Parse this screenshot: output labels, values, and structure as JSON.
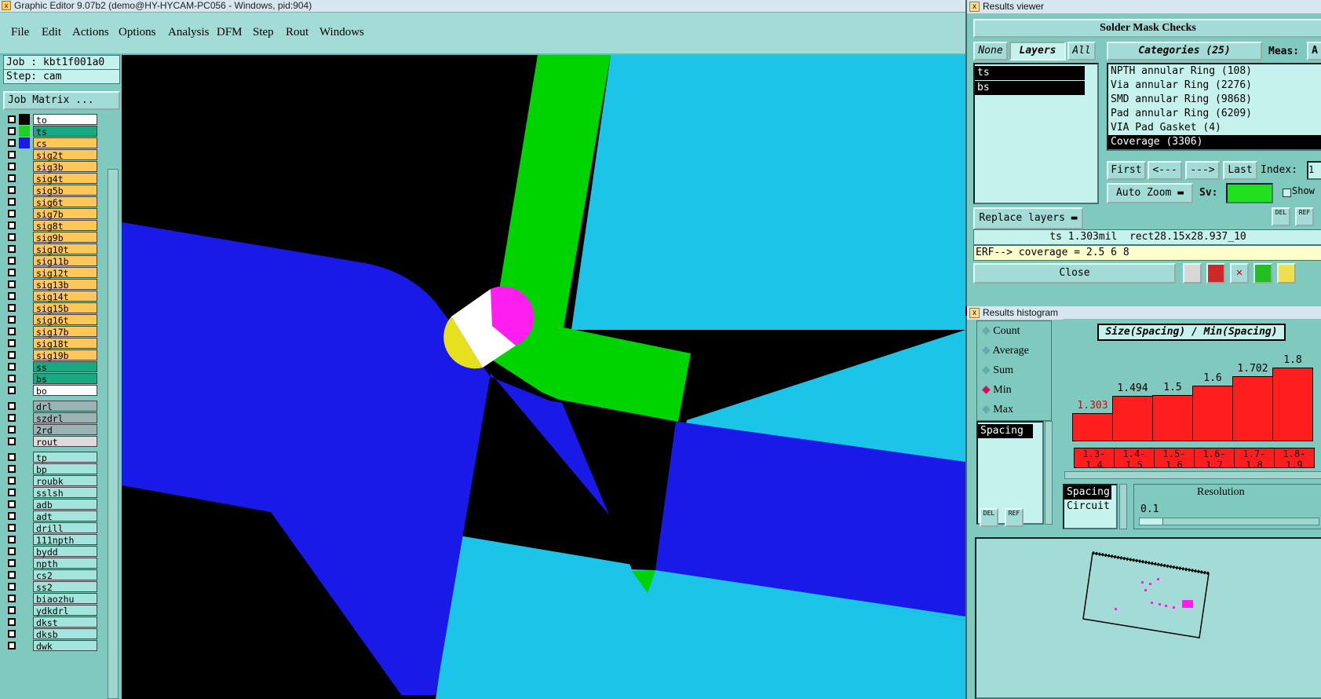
{
  "main_window": {
    "title": "Graphic Editor 9.07b2 (demo@HY-HYCAM-PC056 - Windows, pid:904)",
    "menu": [
      "File",
      "Edit",
      "Actions",
      "Options",
      "Analysis",
      "DFM",
      "Step",
      "Rout",
      "Windows"
    ],
    "job_label": "Job : kbt1f001a0",
    "step_label": "Step: cam",
    "job_matrix_button": "Job Matrix ..."
  },
  "layers": [
    {
      "name": "to",
      "color": "#ffffff",
      "swatch": "#000000"
    },
    {
      "name": "ts",
      "color": "#1aa883",
      "swatch": "#20d020"
    },
    {
      "name": "cs",
      "color": "#ffc65a",
      "swatch": "#1a1ae8"
    },
    {
      "name": "sig2t",
      "color": "#ffc65a",
      "swatch": ""
    },
    {
      "name": "sig3b",
      "color": "#ffc65a",
      "swatch": ""
    },
    {
      "name": "sig4t",
      "color": "#ffc65a",
      "swatch": ""
    },
    {
      "name": "sig5b",
      "color": "#ffc65a",
      "swatch": ""
    },
    {
      "name": "sig6t",
      "color": "#ffc65a",
      "swatch": ""
    },
    {
      "name": "sig7b",
      "color": "#ffc65a",
      "swatch": ""
    },
    {
      "name": "sig8t",
      "color": "#ffc65a",
      "swatch": ""
    },
    {
      "name": "sig9b",
      "color": "#ffc65a",
      "swatch": ""
    },
    {
      "name": "sig10t",
      "color": "#ffc65a",
      "swatch": ""
    },
    {
      "name": "sig11b",
      "color": "#ffc65a",
      "swatch": ""
    },
    {
      "name": "sig12t",
      "color": "#ffc65a",
      "swatch": ""
    },
    {
      "name": "sig13b",
      "color": "#ffc65a",
      "swatch": ""
    },
    {
      "name": "sig14t",
      "color": "#ffc65a",
      "swatch": ""
    },
    {
      "name": "sig15b",
      "color": "#ffc65a",
      "swatch": ""
    },
    {
      "name": "sig16t",
      "color": "#ffc65a",
      "swatch": ""
    },
    {
      "name": "sig17b",
      "color": "#ffc65a",
      "swatch": ""
    },
    {
      "name": "sig18t",
      "color": "#ffc65a",
      "swatch": ""
    },
    {
      "name": "sig19b",
      "color": "#ffc65a",
      "swatch": ""
    },
    {
      "name": "ss",
      "color": "#1aa883",
      "swatch": ""
    },
    {
      "name": "bs",
      "color": "#1aa883",
      "swatch": ""
    },
    {
      "name": "bo",
      "color": "#ffffff",
      "swatch": ""
    },
    {
      "name": "drl",
      "color": "#9ab3b3",
      "swatch": ""
    },
    {
      "name": "szdrl",
      "color": "#9ab3b3",
      "swatch": ""
    },
    {
      "name": "2rd",
      "color": "#9ab3b3",
      "swatch": ""
    },
    {
      "name": "rout",
      "color": "#dcdcdc",
      "swatch": ""
    },
    {
      "name": "tp",
      "color": "#a3e4dc",
      "swatch": ""
    },
    {
      "name": "bp",
      "color": "#a3e4dc",
      "swatch": ""
    },
    {
      "name": "roubk",
      "color": "#a3e4dc",
      "swatch": ""
    },
    {
      "name": "sslsh",
      "color": "#a3e4dc",
      "swatch": ""
    },
    {
      "name": "adb",
      "color": "#a3e4dc",
      "swatch": ""
    },
    {
      "name": "adt",
      "color": "#a3e4dc",
      "swatch": ""
    },
    {
      "name": "drill",
      "color": "#a3e4dc",
      "swatch": ""
    },
    {
      "name": "111npth",
      "color": "#a3e4dc",
      "swatch": ""
    },
    {
      "name": "bydd",
      "color": "#a3e4dc",
      "swatch": ""
    },
    {
      "name": "npth",
      "color": "#a3e4dc",
      "swatch": ""
    },
    {
      "name": "cs2",
      "color": "#a3e4dc",
      "swatch": ""
    },
    {
      "name": "ss2",
      "color": "#a3e4dc",
      "swatch": ""
    },
    {
      "name": "biaozhu",
      "color": "#a3e4dc",
      "swatch": ""
    },
    {
      "name": "ydkdrl",
      "color": "#a3e4dc",
      "swatch": ""
    },
    {
      "name": "dkst",
      "color": "#a3e4dc",
      "swatch": ""
    },
    {
      "name": "dksb",
      "color": "#a3e4dc",
      "swatch": ""
    },
    {
      "name": "dwk",
      "color": "#a3e4dc",
      "swatch": ""
    }
  ],
  "results_viewer": {
    "title": "Results viewer",
    "header": "Solder Mask Checks",
    "tabs": {
      "none": "None",
      "layers": "Layers",
      "all": "All"
    },
    "categories_label": "Categories (25)",
    "meas_label": "Meas:",
    "meas_value": "A",
    "layer_list": [
      "ts",
      "bs"
    ],
    "categories": [
      "NPTH annular Ring (108)",
      "Via annular Ring (2276)",
      "SMD annular Ring (9868)",
      "Pad annular Ring (6209)",
      "VIA Pad Gasket (4)",
      "Coverage (3306)"
    ],
    "nav": {
      "first": "First",
      "prev": "<---",
      "next": "--->",
      "last": "Last",
      "index": "Index:",
      "index_value": "1"
    },
    "auto_zoom": "Auto Zoom",
    "sv_label": "Sv:",
    "show_label": "Show",
    "replace_layers": "Replace layers",
    "del_label": "DEL",
    "ref_label": "REF",
    "measure_text": "ts 1.303mil  rect28.15x28.937_10",
    "erf_text": "ERF--> coverage = 2.5 6 8",
    "close": "Close"
  },
  "results_histogram": {
    "title": "Results histogram",
    "modes": [
      {
        "label": "Count",
        "selected": false
      },
      {
        "label": "Average",
        "selected": false
      },
      {
        "label": "Sum",
        "selected": false
      },
      {
        "label": "Min",
        "selected": true
      },
      {
        "label": "Max",
        "selected": false
      }
    ],
    "measure_list": [
      "Spacing"
    ],
    "chart_title": "Size(Spacing) / Min(Spacing)",
    "bins": [
      {
        "range_top": "1.3-",
        "range_bottom": "1.4",
        "value": 1.303,
        "highlight": true
      },
      {
        "range_top": "1.4-",
        "range_bottom": "1.5",
        "value": 1.494,
        "highlight": false
      },
      {
        "range_top": "1.5-",
        "range_bottom": "1.6",
        "value": 1.5,
        "highlight": false
      },
      {
        "range_top": "1.6-",
        "range_bottom": "1.7",
        "value": 1.6,
        "highlight": false
      },
      {
        "range_top": "1.7-",
        "range_bottom": "1.8",
        "value": 1.702,
        "highlight": false
      },
      {
        "range_top": "1.8-",
        "range_bottom": "1.9",
        "value": 1.8,
        "highlight": false
      }
    ],
    "attr_list": [
      "Spacing",
      "Circuit"
    ],
    "resolution_label": "Resolution",
    "resolution_value": "0.1",
    "del_label": "DEL",
    "ref_label": "REF"
  },
  "colors": {
    "panel": "#7fc9bf",
    "canvas_bg": "#000000",
    "blue_layer": "#1a1ae8",
    "cyan_layer": "#1cc4e8",
    "green_layer": "#00d400",
    "bar": "#ff1e1e"
  }
}
